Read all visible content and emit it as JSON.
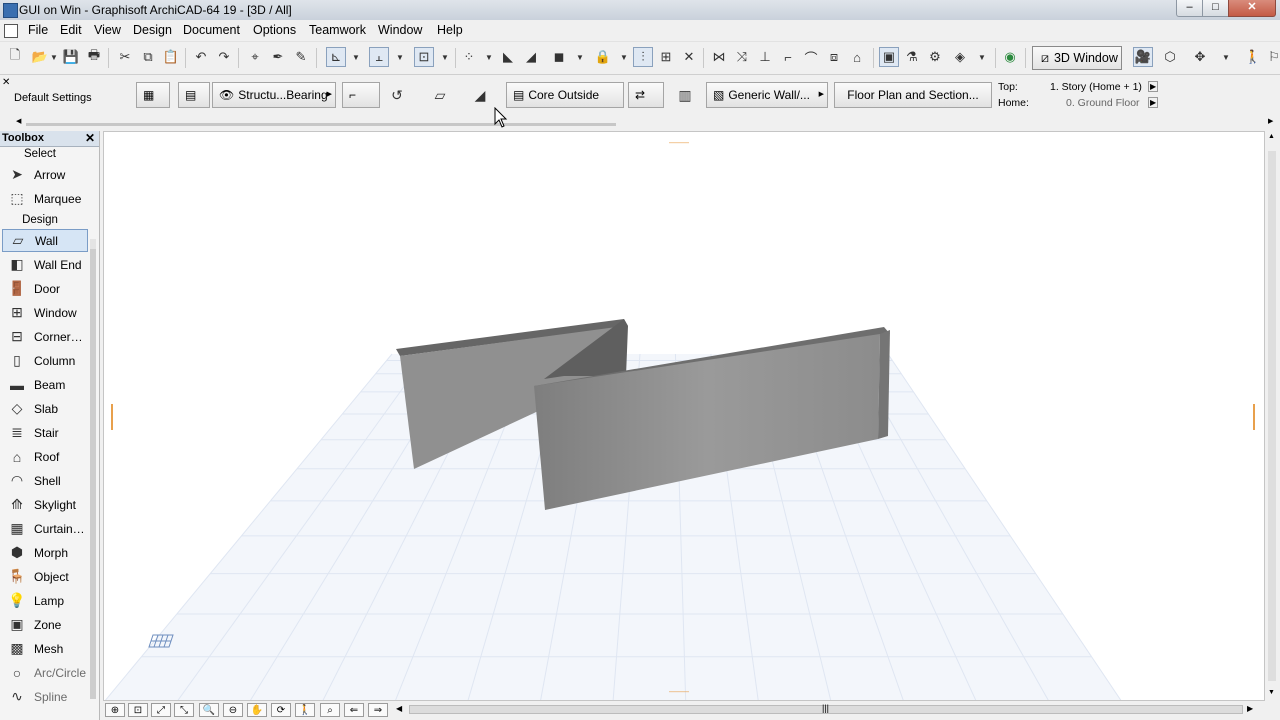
{
  "window": {
    "title": "GUI on Win - Graphisoft ArchiCAD-64 19 - [3D / All]",
    "min": "–",
    "max": "□",
    "close": "✕"
  },
  "menu": [
    "File",
    "Edit",
    "View",
    "Design",
    "Document",
    "Options",
    "Teamwork",
    "Window",
    "Help"
  ],
  "toolbar": {
    "view_button": "3D Window"
  },
  "infobox": {
    "label": "Default Settings",
    "structure": "Structu...Bearing",
    "core": "Core Outside",
    "composite": "Generic Wall/...",
    "floorplan": "Floor Plan and Section...",
    "top_label": "Top:",
    "top_value": "1. Story (Home + 1)",
    "home_label": "Home:",
    "home_value": "0. Ground Floor"
  },
  "toolbox": {
    "title": "Toolbox",
    "close": "✕",
    "groups": {
      "select": "Select",
      "design": "Design"
    },
    "select_tools": [
      {
        "label": "Arrow",
        "icon": "arrow-icon"
      },
      {
        "label": "Marquee",
        "icon": "marquee-icon"
      }
    ],
    "design_tools": [
      {
        "label": "Wall",
        "icon": "wall-icon",
        "selected": true
      },
      {
        "label": "Wall End",
        "icon": "wall-end-icon"
      },
      {
        "label": "Door",
        "icon": "door-icon"
      },
      {
        "label": "Window",
        "icon": "window-icon"
      },
      {
        "label": "Corner…",
        "icon": "corner-window-icon"
      },
      {
        "label": "Column",
        "icon": "column-icon"
      },
      {
        "label": "Beam",
        "icon": "beam-icon"
      },
      {
        "label": "Slab",
        "icon": "slab-icon"
      },
      {
        "label": "Stair",
        "icon": "stair-icon"
      },
      {
        "label": "Roof",
        "icon": "roof-icon"
      },
      {
        "label": "Shell",
        "icon": "shell-icon"
      },
      {
        "label": "Skylight",
        "icon": "skylight-icon"
      },
      {
        "label": "Curtain…",
        "icon": "curtain-wall-icon"
      },
      {
        "label": "Morph",
        "icon": "morph-icon"
      },
      {
        "label": "Object",
        "icon": "object-icon"
      },
      {
        "label": "Lamp",
        "icon": "lamp-icon"
      },
      {
        "label": "Zone",
        "icon": "zone-icon"
      },
      {
        "label": "Mesh",
        "icon": "mesh-icon"
      },
      {
        "label": "Arc/Circle",
        "icon": "arc-circle-icon"
      },
      {
        "label": "Spline",
        "icon": "spline-icon"
      }
    ]
  },
  "colors": {
    "wall_front": "#8f8f8f",
    "wall_top": "#6a6a6a",
    "grid_line": "#dfe6f2",
    "ground": "#f3f6fb",
    "accent": "#7a9cc6"
  }
}
